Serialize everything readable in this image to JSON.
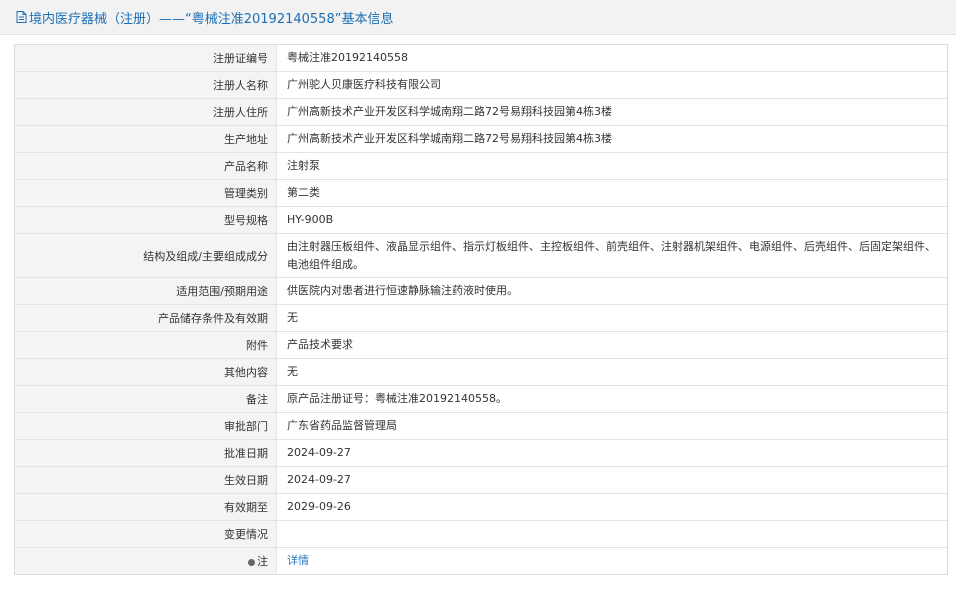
{
  "header": {
    "icon": "document-icon",
    "title": "境内医疗器械（注册）——“粤械注准20192140558”基本信息"
  },
  "colors": {
    "accent": "#1c6fb5",
    "link": "#2a7abf"
  },
  "rows": [
    {
      "label": "注册证编号",
      "value": "粤械注准20192140558"
    },
    {
      "label": "注册人名称",
      "value": "广州驼人贝康医疗科技有限公司"
    },
    {
      "label": "注册人住所",
      "value": "广州高新技术产业开发区科学城南翔二路72号易翔科技园第4栋3楼"
    },
    {
      "label": "生产地址",
      "value": "广州高新技术产业开发区科学城南翔二路72号易翔科技园第4栋3楼"
    },
    {
      "label": "产品名称",
      "value": "注射泵"
    },
    {
      "label": "管理类别",
      "value": "第二类"
    },
    {
      "label": "型号规格",
      "value": "HY-900B"
    },
    {
      "label": "结构及组成/主要组成成分",
      "value": "由注射器压板组件、液晶显示组件、指示灯板组件、主控板组件、前壳组件、注射器机架组件、电源组件、后壳组件、后固定架组件、电池组件组成。"
    },
    {
      "label": "适用范围/预期用途",
      "value": "供医院内对患者进行恒速静脉输注药液时使用。"
    },
    {
      "label": "产品储存条件及有效期",
      "value": "无"
    },
    {
      "label": "附件",
      "value": "产品技术要求"
    },
    {
      "label": "其他内容",
      "value": "无"
    },
    {
      "label": "备注",
      "value": "原产品注册证号：粤械注准20192140558。"
    },
    {
      "label": "审批部门",
      "value": "广东省药品监督管理局"
    },
    {
      "label": "批准日期",
      "value": "2024-09-27"
    },
    {
      "label": "生效日期",
      "value": "2024-09-27"
    },
    {
      "label": "有效期至",
      "value": "2029-09-26"
    },
    {
      "label": "变更情况",
      "value": ""
    }
  ],
  "note_row": {
    "icon": "bullet-dot-icon",
    "label": "注",
    "link_text": "详情"
  }
}
